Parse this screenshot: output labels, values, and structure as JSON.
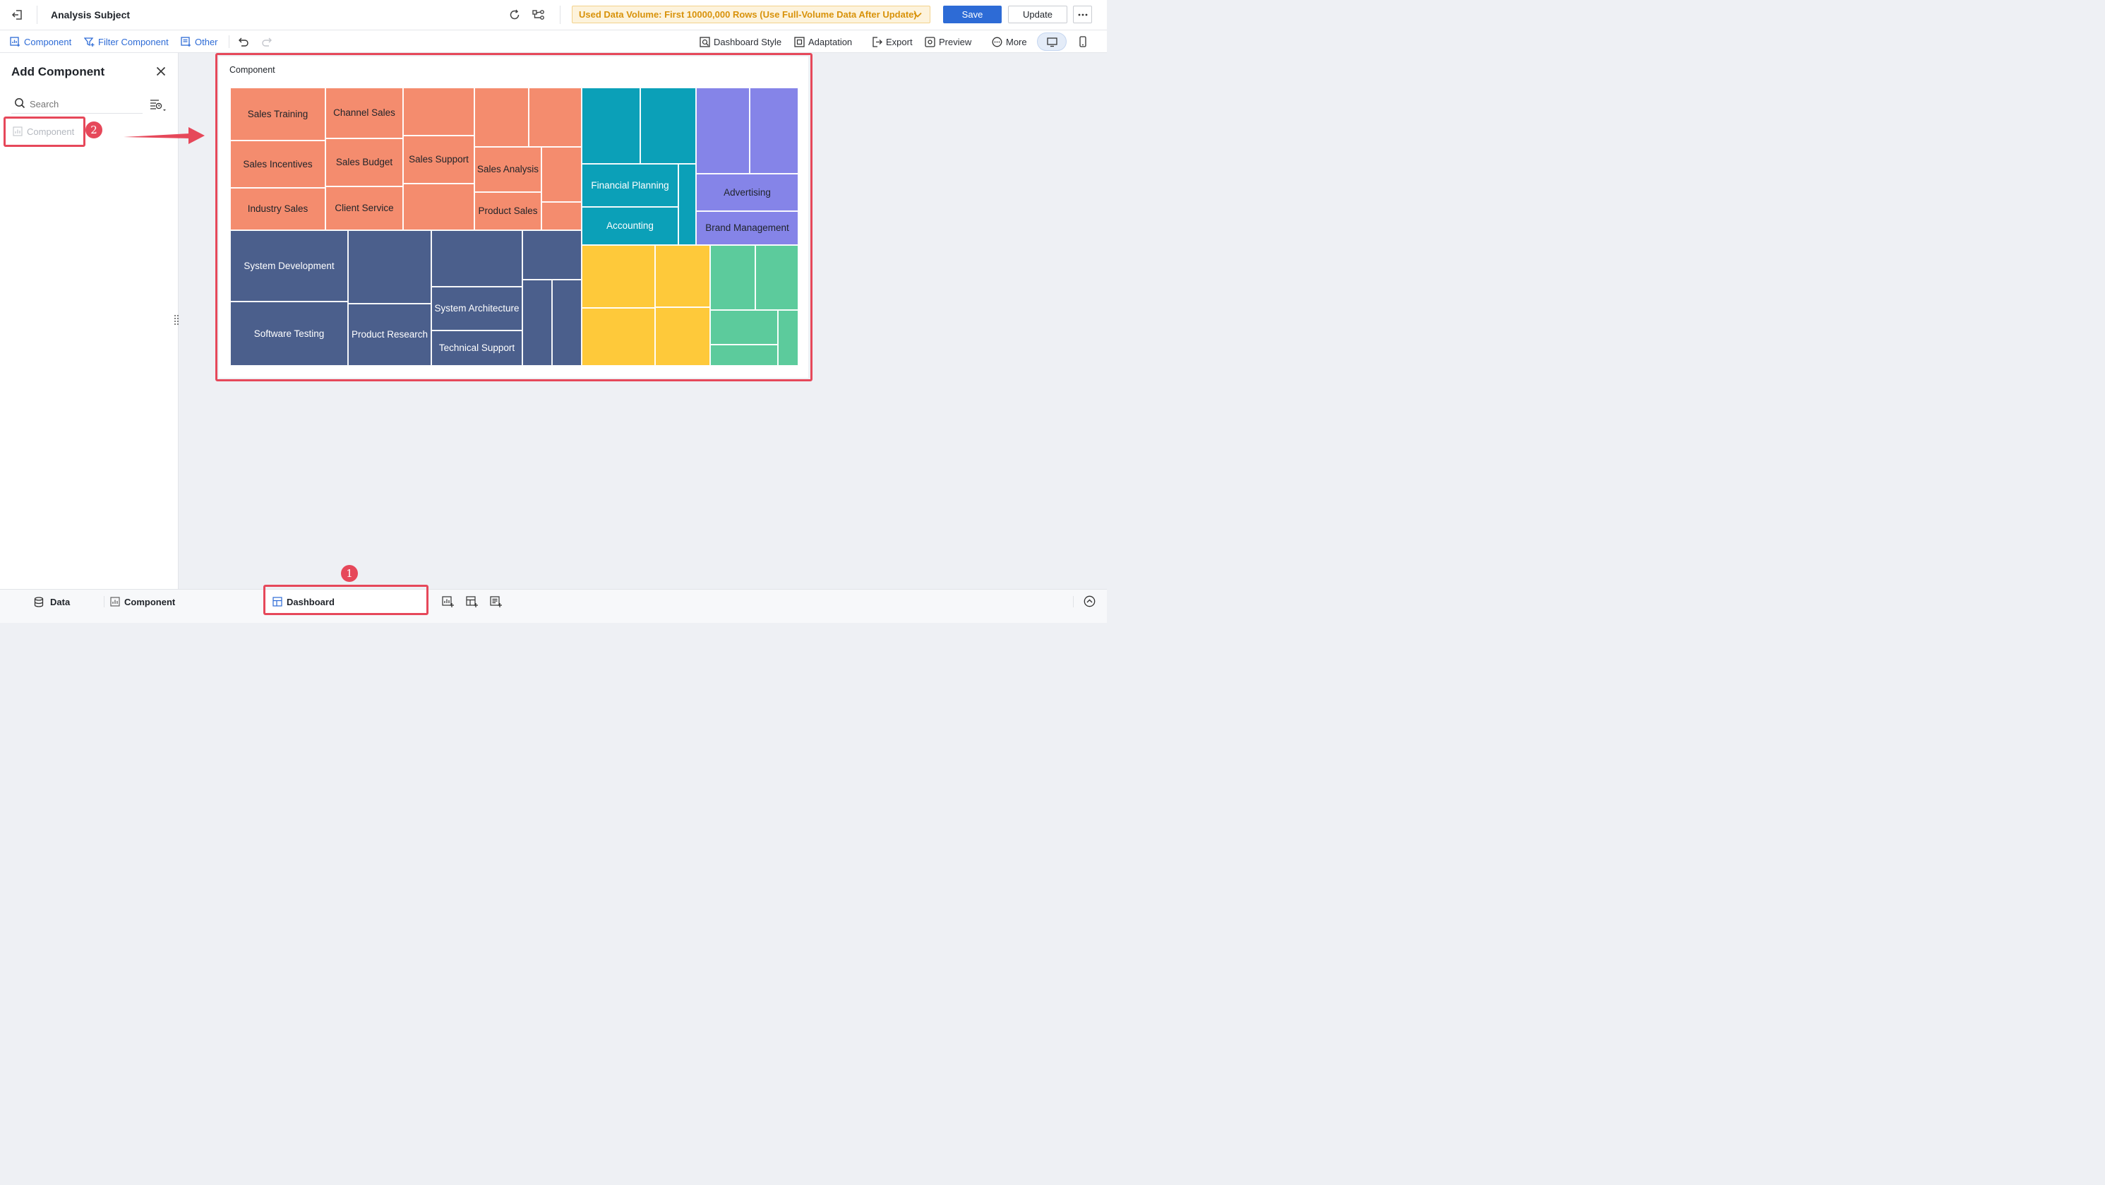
{
  "header": {
    "title": "Analysis Subject",
    "data_notice": "Used Data Volume: First 10000,000 Rows (Use Full-Volume Data After Update)",
    "save_label": "Save",
    "update_label": "Update",
    "icons": [
      "exit-icon",
      "refresh-icon",
      "lineage-icon",
      "chevron-down-icon",
      "more-icon"
    ]
  },
  "toolbar": {
    "left": [
      {
        "label": "Component",
        "icon": "add-chart-icon"
      },
      {
        "label": "Filter Component",
        "icon": "filter-add-icon"
      },
      {
        "label": "Other",
        "icon": "other-add-icon"
      }
    ],
    "right": [
      {
        "label": "Dashboard Style",
        "icon": "style-icon"
      },
      {
        "label": "Adaptation",
        "icon": "adaptation-icon"
      },
      {
        "label": "Export",
        "icon": "export-icon"
      },
      {
        "label": "Preview",
        "icon": "preview-icon"
      },
      {
        "label": "More",
        "icon": "more-circle-icon"
      }
    ],
    "view_icons": [
      "desktop-icon",
      "mobile-icon"
    ]
  },
  "panel": {
    "title": "Add Component",
    "search_placeholder": "Search",
    "item_label": "Component"
  },
  "canvas": {
    "component_title": "Component"
  },
  "bottom": {
    "data_tab": "Data",
    "component_tab": "Component",
    "dashboard_tab": "Dashboard"
  },
  "annotations": {
    "badge_1": "1",
    "badge_2": "2",
    "highlight_color": "#e6485a"
  },
  "colors": {
    "primary": "#2d6bd6",
    "notice_bg": "#fdf3dc",
    "notice_text": "#d8920a"
  },
  "chart_data": {
    "type": "treemap",
    "title": "",
    "groups": [
      {
        "color": "#f48c6e",
        "items": [
          "Sales Training",
          "Channel Sales",
          "",
          "",
          "",
          "Sales Incentives",
          "Sales Budget",
          "Sales Support",
          "Sales Analysis",
          "",
          "Industry Sales",
          "Client Service",
          "",
          "Product Sales",
          ""
        ]
      },
      {
        "color": "#0ba0b8",
        "items": [
          "",
          "",
          "Financial Planning",
          "Accounting",
          ""
        ]
      },
      {
        "color": "#8584e8",
        "items": [
          "",
          "",
          "Advertising",
          "Brand Management"
        ]
      },
      {
        "color": "#4b5f8c",
        "items": [
          "System Development",
          "Software Testing",
          "",
          "Product Research",
          "",
          "System Architecture",
          "Technical Support",
          "",
          "",
          ""
        ]
      },
      {
        "color": "#fec93a",
        "items": [
          "",
          "",
          "",
          ""
        ]
      },
      {
        "color": "#5ccb9c",
        "items": [
          "",
          "",
          "",
          "",
          ""
        ]
      }
    ]
  }
}
